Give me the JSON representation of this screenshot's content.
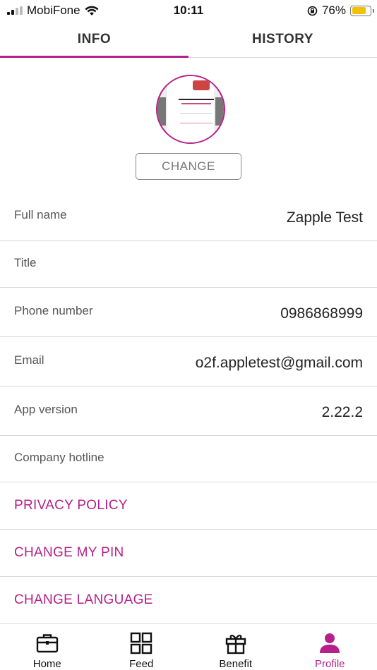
{
  "status_bar": {
    "carrier": "MobiFone",
    "time": "10:11",
    "battery_percent": "76%",
    "battery_level": 0.76
  },
  "tabs": [
    {
      "label": "INFO",
      "active": true
    },
    {
      "label": "HISTORY",
      "active": false
    }
  ],
  "profile": {
    "change_label": "CHANGE"
  },
  "fields": [
    {
      "label": "Full name",
      "value": "Zapple Test"
    },
    {
      "label": "Title",
      "value": ""
    },
    {
      "label": "Phone number",
      "value": "0986868999"
    },
    {
      "label": "Email",
      "value": "o2f.appletest@gmail.com"
    },
    {
      "label": "App version",
      "value": "2.22.2"
    },
    {
      "label": "Company hotline",
      "value": ""
    }
  ],
  "links": [
    {
      "label": "PRIVACY POLICY"
    },
    {
      "label": "CHANGE MY PIN"
    },
    {
      "label": "CHANGE LANGUAGE"
    }
  ],
  "bottom_nav": [
    {
      "label": "Home",
      "icon": "briefcase-icon",
      "active": false
    },
    {
      "label": "Feed",
      "icon": "grid-icon",
      "active": false
    },
    {
      "label": "Benefit",
      "icon": "gift-icon",
      "active": false
    },
    {
      "label": "Profile",
      "icon": "person-icon",
      "active": true
    }
  ],
  "colors": {
    "accent": "#b5208a",
    "battery": "#f2c200"
  }
}
